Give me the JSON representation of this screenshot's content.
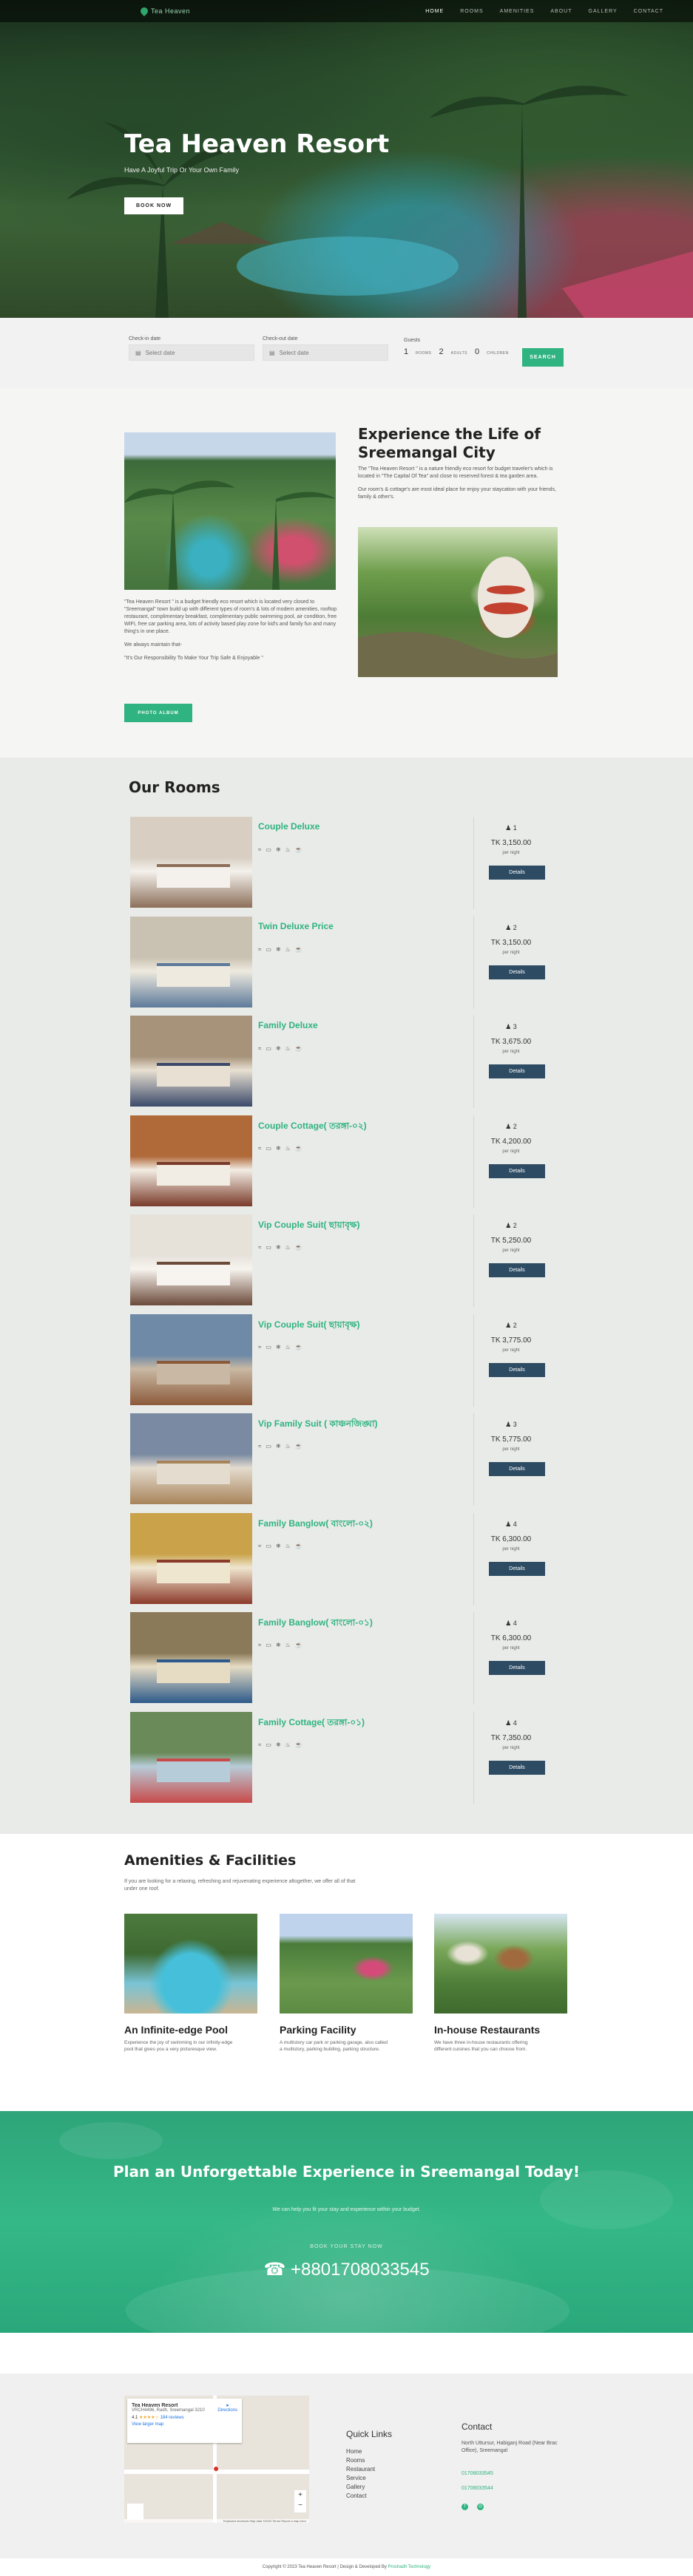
{
  "nav": {
    "logo": "Tea Heaven",
    "items": [
      "HOME",
      "ROOMS",
      "AMENITIES",
      "ABOUT",
      "GALLERY",
      "CONTACT"
    ]
  },
  "hero": {
    "title": "Tea Heaven Resort",
    "subtitle": "Have A Joyful Trip Or Your Own Family",
    "button": "BOOK NOW"
  },
  "booking": {
    "checkin_label": "Check-in date",
    "checkout_label": "Check-out date",
    "date_placeholder": "Select date",
    "guests_label": "Guests",
    "rooms_count": "1",
    "rooms_text": "ROOMS",
    "adults_count": "2",
    "adults_text": "ADULTS",
    "children_count": "0",
    "children_text": "CHILDREN",
    "search": "SEARCH"
  },
  "about": {
    "text1": "\"Tea Heaven Resort \" is a budget friendly eco resort which is located very closed to \"Sreemangal\" town build up with different types of room's & lots of modern amenities, rooftop restaurant, complimentary breakfast, complimentary public swimming pool, air condition, free WIFI, free car parking area, lots of activity based play zone for kid's and family fun and many thing's in one place.",
    "text2": "We always maintain that-",
    "text3": "\"It's Our Responsibility To Make Your Trip Safe & Enjoyable \"",
    "button": "PHOTO ALBUM",
    "title": "Experience the Life of Sreemangal City",
    "desc1": "The \"Tea Heaven Resort \" is a nature friendly eco resort for budget traveler's which is located in \"The Capital Of Tea\" and close to reserved forest & tea garden area.",
    "desc2": "Our room's & cottage's are most ideal place for enjoy your staycation with your friends, family & other's."
  },
  "rooms": {
    "title": "Our Rooms",
    "per_night": "per night",
    "details": "Details",
    "items": [
      {
        "name": "Couple Deluxe",
        "guests": "1",
        "price": "TK 3,150.00"
      },
      {
        "name": "Twin Deluxe Price",
        "guests": "2",
        "price": "TK 3,150.00"
      },
      {
        "name": "Family Deluxe",
        "guests": "3",
        "price": "TK 3,675.00"
      },
      {
        "name": "Couple Cottage( তরঙ্গা-০২)",
        "guests": "2",
        "price": "TK 4,200.00"
      },
      {
        "name": "Vip Couple Suit( ছায়াবৃক্ষ)",
        "guests": "2",
        "price": "TK 5,250.00"
      },
      {
        "name": "Vip Couple Suit( ছায়াবৃক্ষ)",
        "guests": "2",
        "price": "TK 3,775.00"
      },
      {
        "name": "Vip Family Suit ( কাঞ্চনজিঙ্ঘা)",
        "guests": "3",
        "price": "TK 5,775.00"
      },
      {
        "name": "Family Banglow( বাংলো-০২)",
        "guests": "4",
        "price": "TK 6,300.00"
      },
      {
        "name": "Family Banglow( বাংলো-০১)",
        "guests": "4",
        "price": "TK 6,300.00"
      },
      {
        "name": "Family Cottage( তরঙ্গা-০১)",
        "guests": "4",
        "price": "TK 7,350.00"
      }
    ]
  },
  "amenities": {
    "title": "Amenities & Facilities",
    "desc": "If you are looking for a relaxing, refreshing and rejuvenating experience altogether, we offer all of that under one roof.",
    "items": [
      {
        "title": "An Infinite-edge Pool",
        "text": "Experience the joy of swimming in our infinity-edge pool that gives you a very picturesque view."
      },
      {
        "title": "Parking Facility",
        "text": "A multistory car park or parking garage, also called a multistory, parking building, parking structure."
      },
      {
        "title": "In-house Restaurants",
        "text": "We have three in-house restaurants offering different cuisines that you can choose from."
      }
    ]
  },
  "cta": {
    "title": "Plan an Unforgettable Experience in Sreemangal Today!",
    "sub": "We can help you fit your stay and experience within your budget.",
    "label": "BOOK YOUR STAY NOW",
    "phone": "+8801708033545"
  },
  "footer": {
    "map_title": "Tea Heaven Resort",
    "map_addr": "VRCH4496, Radh, Sreemangal 3210",
    "map_rating": "4.1",
    "map_reviews": "184 reviews",
    "map_link": "View larger map",
    "map_dir": "Directions",
    "map_bottom": "Keyboard shortcuts   Map data ©2023   Terms   Report a map error",
    "quick_title": "Quick Links",
    "links": [
      "Home",
      "Rooms",
      "Restaurant",
      "Service",
      "Gallery",
      "Contact"
    ],
    "contact_title": "Contact",
    "address": "North Uttursur, Habiganj Road (Near Brac Office), Sreemangal",
    "phone1": "01708033545",
    "phone2": "01708033544",
    "copyright": "Copyright © 2023 Tea Heaven Resort | Design & Developed By",
    "developer": "Proshadh Technology"
  },
  "colors": {
    "accent": "#2fb380",
    "button_dark": "#2d4b63"
  }
}
